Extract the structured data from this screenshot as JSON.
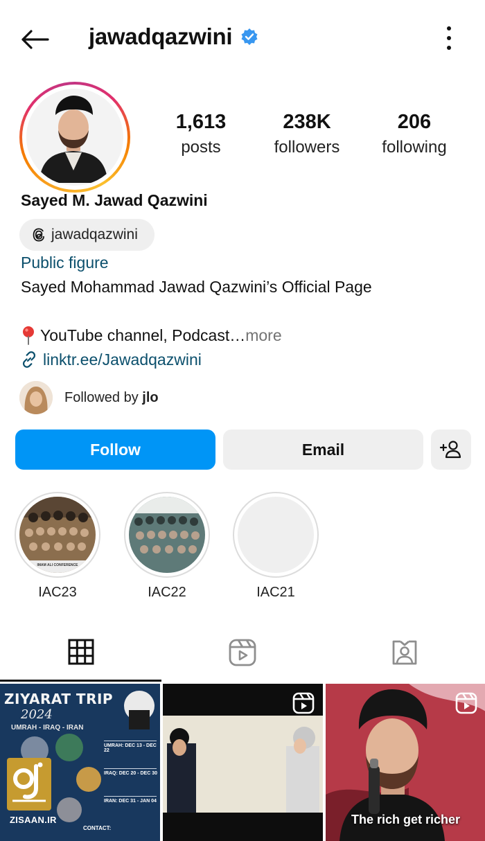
{
  "header": {
    "username": "jawadqazwini",
    "verified": true,
    "icons": {
      "back": "arrow-left-icon",
      "menu": "kebab-menu-icon",
      "verified": "verified-badge-icon"
    }
  },
  "stats": [
    {
      "value": "1,613",
      "label": "posts"
    },
    {
      "value": "238K",
      "label": "followers"
    },
    {
      "value": "206",
      "label": "following"
    }
  ],
  "profile": {
    "full_name": "Sayed M. Jawad Qazwini",
    "threads_handle": "jawadqazwini",
    "category": "Public figure",
    "bio_line1": "Sayed Mohammad Jawad Qazwini’s Official Page",
    "bio_line2": "YouTube channel, Podcast…",
    "more": "more",
    "link": "linktr.ee/Jawadqazwini",
    "followed_by_prefix": "Followed by ",
    "followed_by_user": "jlo"
  },
  "actions": {
    "follow": "Follow",
    "email": "Email",
    "add_user_icon": "add-user-icon"
  },
  "highlights": [
    {
      "label": "IAC23",
      "caption": "IMAM ALI CONFERENCE"
    },
    {
      "label": "IAC22",
      "caption": ""
    },
    {
      "label": "IAC21",
      "caption": ""
    }
  ],
  "tabs": [
    {
      "name": "posts",
      "icon": "grid-icon",
      "active": true
    },
    {
      "name": "reels",
      "icon": "reels-icon",
      "active": false
    },
    {
      "name": "tagged",
      "icon": "tagged-icon",
      "active": false
    }
  ],
  "posts": [
    {
      "type": "image",
      "title": "ZIYARAT TRIP",
      "year": "2024",
      "subtitle": "UMRAH - IRAQ - IRAN",
      "contact": "CONTACT:",
      "packages": [
        "UMRAH: DEC 13 - DEC 22",
        "IRAQ: DEC 20 - DEC 30",
        "IRAN: DEC 31 - JAN 04"
      ]
    },
    {
      "type": "reel",
      "caption": ""
    },
    {
      "type": "reel",
      "caption": "The rich get richer"
    }
  ],
  "watermark": {
    "text": "ZISAAN.IR"
  },
  "colors": {
    "follow_button": "#0095f6",
    "secondary_button": "#efefef",
    "link": "#0b4f6c",
    "muted": "#737373"
  }
}
